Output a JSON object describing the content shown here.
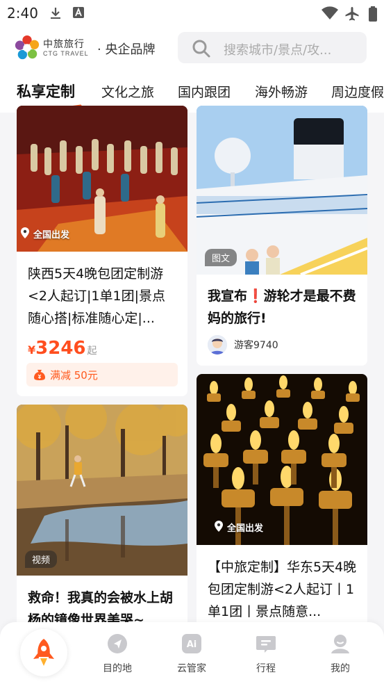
{
  "status_bar": {
    "time": "2:40"
  },
  "header": {
    "brand_cn": "中旅旅行",
    "brand_en": "CTG TRAVEL",
    "slogan": "· 央企品牌",
    "search_placeholder": "搜索城市/景点/攻..."
  },
  "tabs": [
    {
      "label": "私享定制",
      "active": true
    },
    {
      "label": "文化之旅"
    },
    {
      "label": "国内跟团"
    },
    {
      "label": "海外畅游"
    },
    {
      "label": "周边度假"
    }
  ],
  "cards": {
    "shaanxi": {
      "location": "全国出发",
      "title": "陕西5天4晚包团定制游<2人起订|1单1团|景点随心搭|标准随心定|...",
      "price_currency": "¥",
      "price": "3246",
      "price_suffix": "起",
      "promo": "满减 50元"
    },
    "cruise": {
      "tag": "图文",
      "title": "我宣布❗游轮才是最不费妈的旅行!",
      "author": "游客9740"
    },
    "poplar": {
      "tag": "视频",
      "title": "救命！我真的会被水上胡杨的镜像世界美哭~"
    },
    "huadong": {
      "location": "全国出发",
      "title": "【中旅定制】华东5天4晚包团定制游<2人起订丨1单1团丨景点随意..."
    }
  },
  "bottom_nav": [
    {
      "label": "目的地",
      "icon": "navigation-icon"
    },
    {
      "label": "云管家",
      "icon": "ai-assistant-icon"
    },
    {
      "label": "行程",
      "icon": "itinerary-icon"
    },
    {
      "label": "我的",
      "icon": "profile-icon"
    }
  ],
  "colors": {
    "accent": "#ff5a1f",
    "price": "#ff4e1f"
  }
}
